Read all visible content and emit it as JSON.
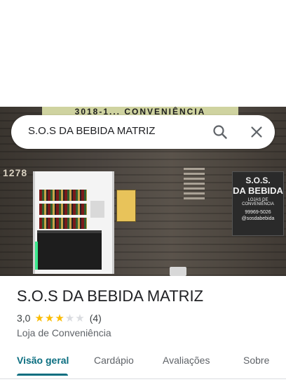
{
  "search": {
    "query": "S.O.S DA BEBIDA MATRIZ"
  },
  "hero": {
    "top_sign": "3018-1...  CONVENIÊNCIA",
    "street_number": "1278",
    "board": {
      "line1": "S.O.S.",
      "line2": "DA BEBIDA",
      "line3": "LOJAS DE CONVENIÊNCIA",
      "line4": "99969-5026",
      "line5": "@sosdabebida"
    }
  },
  "place": {
    "name": "S.O.S DA BEBIDA MATRIZ",
    "rating": "3,0",
    "stars_filled": 3,
    "stars_total": 5,
    "reviews": "(4)",
    "category": "Loja de Conveniência"
  },
  "tabs": [
    {
      "label": "Visão geral",
      "active": true
    },
    {
      "label": "Cardápio",
      "active": false
    },
    {
      "label": "Avaliações",
      "active": false
    },
    {
      "label": "Sobre",
      "active": false
    }
  ],
  "colors": {
    "accent": "#0b6e80",
    "star": "#fbbc04",
    "star_empty": "#dadce0"
  },
  "icons": {
    "search": "search-icon",
    "close": "close-icon"
  }
}
